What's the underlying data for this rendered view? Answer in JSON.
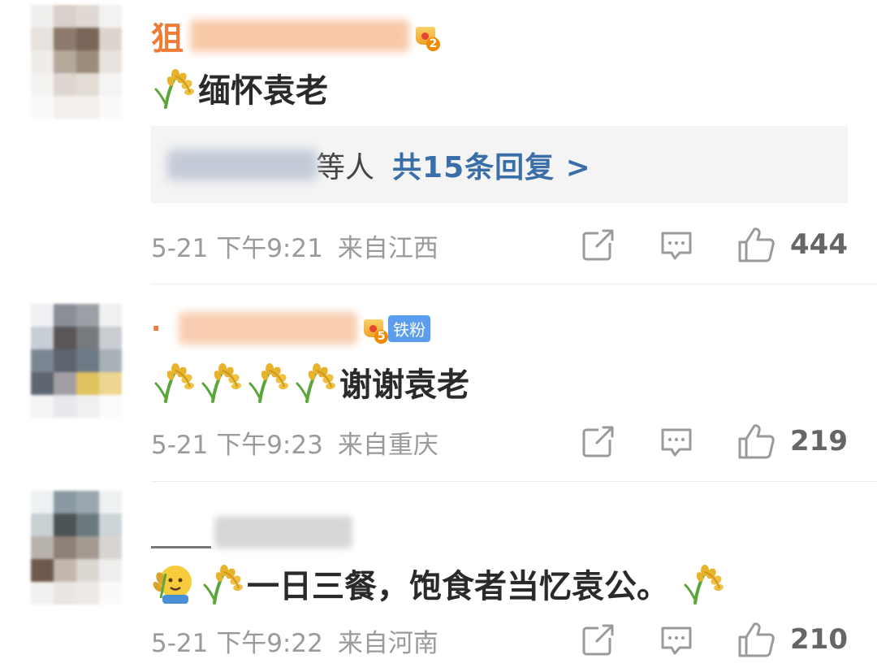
{
  "comments": [
    {
      "name_visible": "狙",
      "level": "2",
      "content": "缅怀袁老",
      "reply_tail": "等人",
      "reply_link": "共15条回复 >",
      "time": "5-21 下午9:21",
      "location": "来自江西",
      "likes": "444",
      "icons": [
        "rice-icon"
      ]
    },
    {
      "name_visible": "·",
      "level": "5",
      "fan_badge": "铁粉",
      "content": "谢谢袁老",
      "time": "5-21 下午9:23",
      "location": "来自重庆",
      "likes": "219",
      "icons": [
        "rice-icon",
        "rice-icon",
        "rice-icon",
        "rice-icon"
      ]
    },
    {
      "name_visible": "",
      "content": "一日三餐，饱食者当忆袁公。",
      "time": "5-21 下午9:22",
      "location": "来自河南",
      "likes": "210",
      "icons": [
        "farmer-face-icon",
        "rice-icon",
        "rice-icon"
      ]
    }
  ],
  "colors": {
    "username": "#ef7c35",
    "link": "#3a6ea8",
    "meta": "#9a9a9a",
    "badge": "#5b9ef0"
  }
}
